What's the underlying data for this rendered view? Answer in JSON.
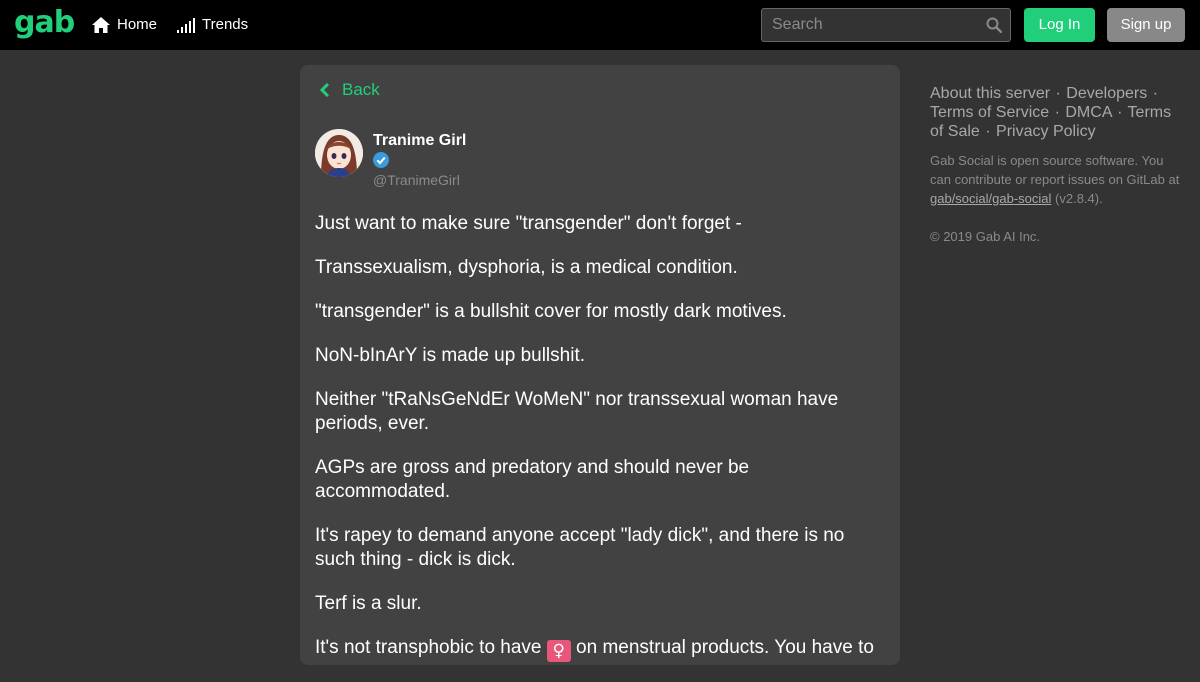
{
  "brand": {
    "logo_text": "gab",
    "accent_color": "#21cf7a"
  },
  "nav": {
    "home_label": "Home",
    "trends_label": "Trends",
    "search_placeholder": "Search",
    "search_value": "",
    "login_label": "Log In",
    "signup_label": "Sign up"
  },
  "post": {
    "back_label": "Back",
    "author": {
      "display_name": "Tranime Girl",
      "handle": "@TranimeGirl",
      "verified": true
    },
    "paragraphs": [
      "Just want to make sure \"transgender\" don't forget -",
      "Transsexualism, dysphoria, is a medical condition.",
      "\"transgender\" is a bullshit cover for mostly dark motives.",
      "NoN-bInArY is made up bullshit.",
      "Neither \"tRaNsGeNdEr WoMeN\" nor transsexual woman have periods, ever.",
      "AGPs are gross and predatory and should never be accommodated.",
      "It's rapey to demand anyone accept \"lady dick\", and there is no such thing - dick is dick.",
      "Terf is a slur."
    ],
    "last_paragraph": {
      "before": "It's not transphobic to have ",
      "emoji": "♀",
      "after": " on menstrual products. You have to"
    }
  },
  "sidebar": {
    "links": [
      "About this server",
      "Developers",
      "Terms of Service",
      "DMCA",
      "Terms of Sale",
      "Privacy Policy"
    ],
    "info_text_before": "Gab Social is open source software. You can contribute or report issues on GitLab at ",
    "info_link": "gab/social/gab-social",
    "info_version": " (v2.8.4).",
    "copyright": "© 2019 Gab AI Inc."
  }
}
